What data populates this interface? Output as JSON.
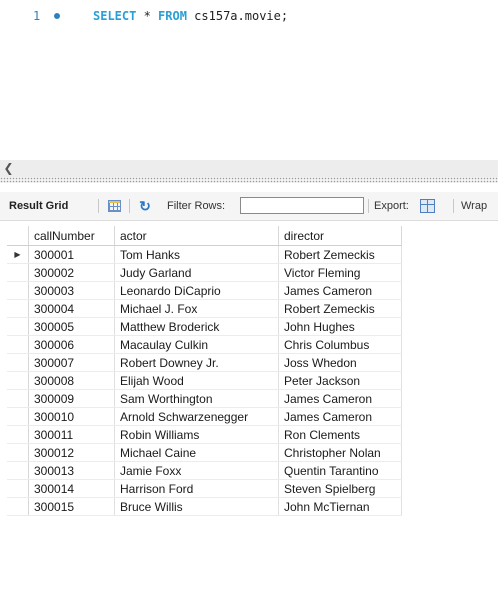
{
  "editor": {
    "line_number": "1",
    "keyword_select": "SELECT",
    "middle": " * ",
    "keyword_from": "FROM",
    "target": " cs157a.movie;"
  },
  "toolbar": {
    "result_grid_label": "Result Grid",
    "filter_label": "Filter Rows:",
    "filter_value": "",
    "export_label": "Export:",
    "wrap_label": "Wrap"
  },
  "grid": {
    "columns": [
      "callNumber",
      "actor",
      "director"
    ],
    "rows": [
      [
        "300001",
        "Tom Hanks",
        "Robert Zemeckis"
      ],
      [
        "300002",
        "Judy Garland",
        "Victor Fleming"
      ],
      [
        "300003",
        "Leonardo DiCaprio",
        "James Cameron"
      ],
      [
        "300004",
        "Michael J. Fox",
        "Robert Zemeckis"
      ],
      [
        "300005",
        "Matthew Broderick",
        "John Hughes"
      ],
      [
        "300006",
        "Macaulay Culkin",
        "Chris Columbus"
      ],
      [
        "300007",
        "Robert Downey Jr.",
        "Joss Whedon"
      ],
      [
        "300008",
        "Elijah Wood",
        "Peter Jackson"
      ],
      [
        "300009",
        "Sam Worthington",
        "James Cameron"
      ],
      [
        "300010",
        "Arnold Schwarzenegger",
        "James Cameron"
      ],
      [
        "300011",
        "Robin Williams",
        "Ron Clements"
      ],
      [
        "300012",
        "Michael Caine",
        "Christopher Nolan"
      ],
      [
        "300013",
        "Jamie Foxx",
        "Quentin Tarantino"
      ],
      [
        "300014",
        "Harrison Ford",
        "Steven Spielberg"
      ],
      [
        "300015",
        "Bruce Willis",
        "John McTiernan"
      ]
    ]
  }
}
